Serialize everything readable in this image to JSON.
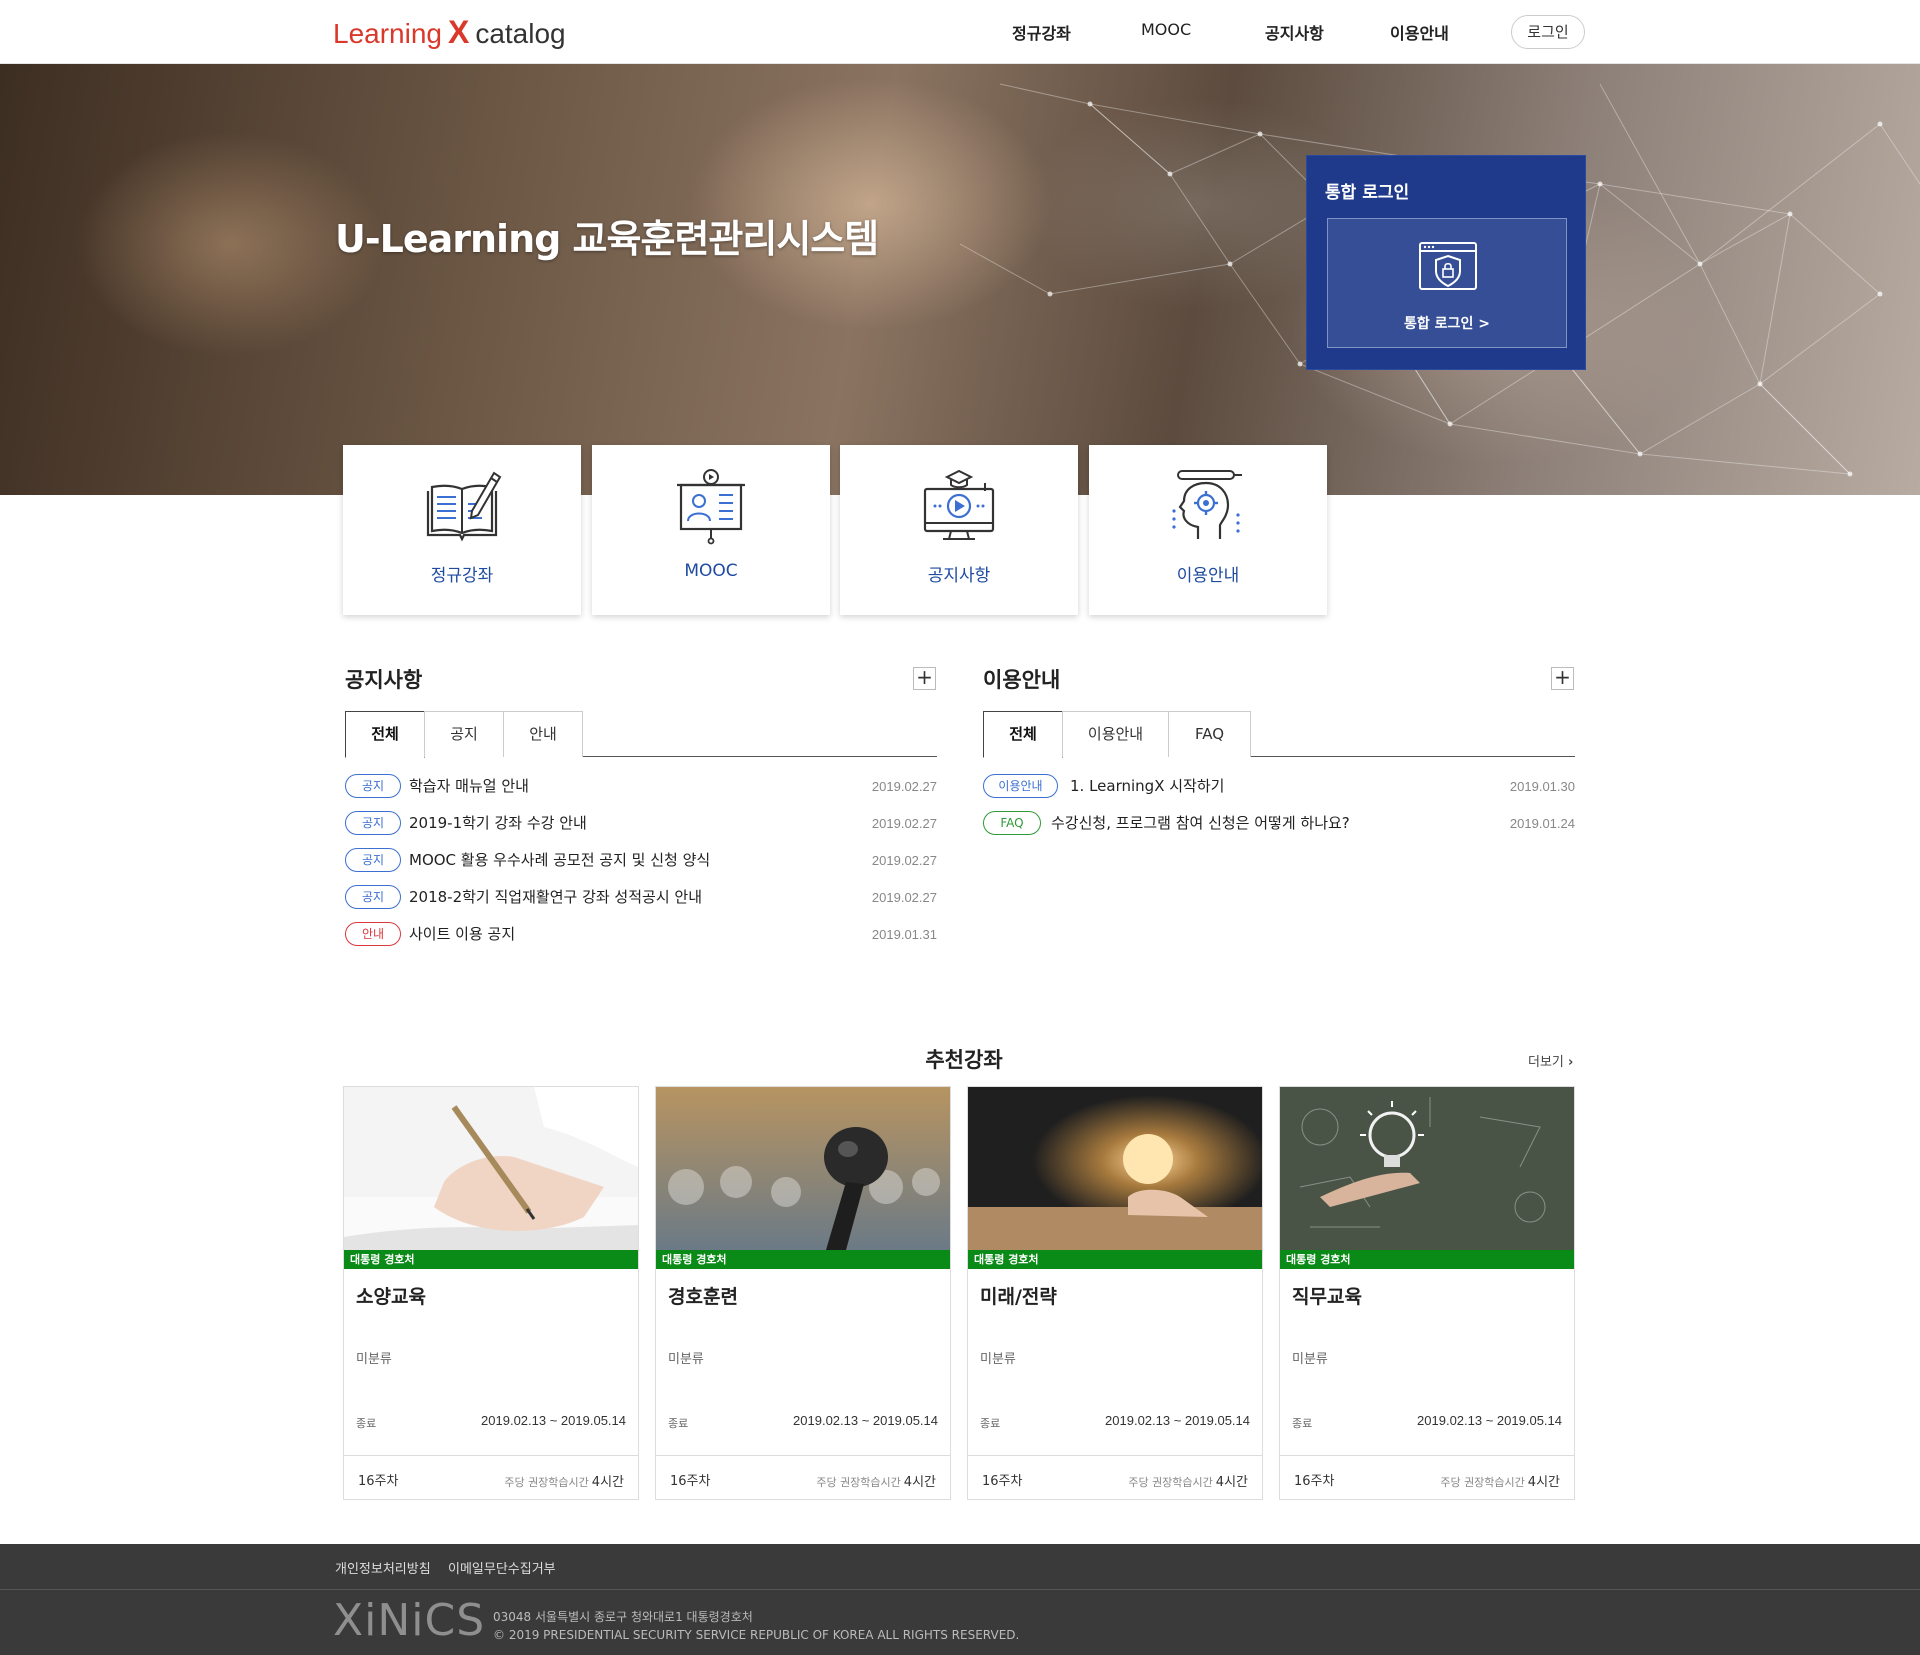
{
  "header": {
    "logo_left": "Learning",
    "logo_mark": "X",
    "logo_right": "catalog",
    "nav": [
      "정규강좌",
      "MOOC",
      "공지사항",
      "이용안내"
    ],
    "login_label": "로그인"
  },
  "hero": {
    "title": "U-Learning 교육훈련관리시스템",
    "login_panel_title": "통합 로그인",
    "login_panel_link": "통합 로그인 >"
  },
  "quick_menu": [
    "정규강좌",
    "MOOC",
    "공지사항",
    "이용안내"
  ],
  "notice_board": {
    "title": "공지사항",
    "tabs": [
      "전체",
      "공지",
      "안내"
    ],
    "posts": [
      {
        "badge": "공지",
        "title": "학습자 매뉴얼 안내",
        "date": "2019.02.27"
      },
      {
        "badge": "공지",
        "title": "2019-1학기 강좌 수강 안내",
        "date": "2019.02.27"
      },
      {
        "badge": "공지",
        "title": "MOOC 활용 우수사례 공모전 공지 및 신청 양식",
        "date": "2019.02.27"
      },
      {
        "badge": "공지",
        "title": "2018-2학기 직업재활연구 강좌 성적공시 안내",
        "date": "2019.02.27"
      },
      {
        "badge": "안내",
        "title": "사이트 이용 공지",
        "date": "2019.01.31"
      }
    ]
  },
  "guide_board": {
    "title": "이용안내",
    "tabs": [
      "전체",
      "이용안내",
      "FAQ"
    ],
    "posts": [
      {
        "badge": "이용안내",
        "title": "1. LearningX 시작하기",
        "date": "2019.01.30"
      },
      {
        "badge": "FAQ",
        "title": "수강신청, 프로그램 참여 신청은 어떻게 하나요?",
        "date": "2019.01.24"
      }
    ]
  },
  "recommended": {
    "title": "추천강좌",
    "more_label": "더보기",
    "courses": [
      {
        "tag": "대통령 경호처",
        "name": "소양교육",
        "category": "미분류",
        "status": "종료",
        "period": "2019.02.13 ~ 2019.05.14",
        "weeks": "16주차",
        "hours_label": "주당 권장학습시간",
        "hours": "4시간"
      },
      {
        "tag": "대통령 경호처",
        "name": "경호훈련",
        "category": "미분류",
        "status": "종료",
        "period": "2019.02.13 ~ 2019.05.14",
        "weeks": "16주차",
        "hours_label": "주당 권장학습시간",
        "hours": "4시간"
      },
      {
        "tag": "대통령 경호처",
        "name": "미래/전략",
        "category": "미분류",
        "status": "종료",
        "period": "2019.02.13 ~ 2019.05.14",
        "weeks": "16주차",
        "hours_label": "주당 권장학습시간",
        "hours": "4시간"
      },
      {
        "tag": "대통령 경호처",
        "name": "직무교육",
        "category": "미분류",
        "status": "종료",
        "period": "2019.02.13 ~ 2019.05.14",
        "weeks": "16주차",
        "hours_label": "주당 권장학습시간",
        "hours": "4시간"
      }
    ]
  },
  "footer": {
    "links": [
      "개인정보처리방침",
      "이메일무단수집거부"
    ],
    "logo": "XiNiCS",
    "address": "03048 서울특별시 종로구 청와대로1 대통령경호처",
    "copyright": "© 2019 PRESIDENTIAL SECURITY SERVICE REPUBLIC OF KOREA ALL RIGHTS RESERVED."
  },
  "colors": {
    "brand_red": "#d9382a",
    "login_panel": "#1f3a8a",
    "link_blue": "#1f4ba0",
    "course_tag_green": "#0a8a17",
    "footer_bg": "#3a3a3a"
  }
}
